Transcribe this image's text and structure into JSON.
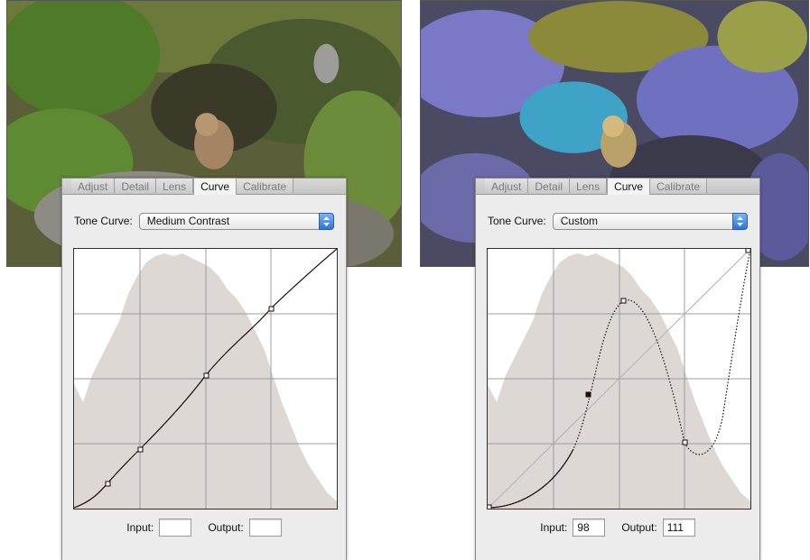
{
  "tabs": [
    "Adjust",
    "Detail",
    "Lens",
    "Curve",
    "Calibrate"
  ],
  "active_tab": "Curve",
  "left_panel": {
    "tone_curve_label": "Tone Curve:",
    "tone_curve_value": "Medium Contrast",
    "input_label": "Input:",
    "input_value": "",
    "output_label": "Output:",
    "output_value": ""
  },
  "right_panel": {
    "tone_curve_label": "Tone Curve:",
    "tone_curve_value": "Custom",
    "input_label": "Input:",
    "input_value": "98",
    "output_label": "Output:",
    "output_value": "111"
  },
  "colors": {
    "histogram": "#ddd8d4",
    "select_accent": "#2e73d8",
    "curve_line": "#1a0a0a"
  },
  "icons": {
    "select_arrow": "up-down-arrows-icon",
    "curve_point": "square-handle-icon"
  }
}
